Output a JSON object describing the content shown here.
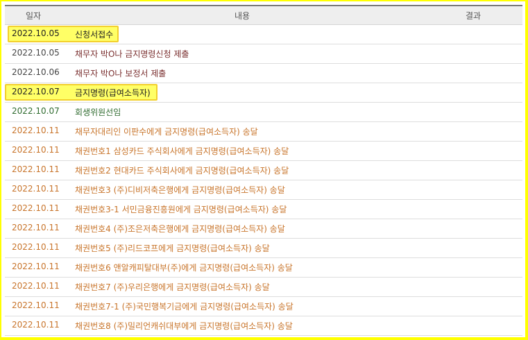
{
  "headers": {
    "date": "일자",
    "content": "내용",
    "result": "결과"
  },
  "rows": [
    {
      "date": "2022.10.05",
      "content": "신청서접수"
    },
    {
      "date": "2022.10.05",
      "content": "채무자 박O나 금지명령신청 제출"
    },
    {
      "date": "2022.10.06",
      "content": "채무자 박O나 보정서 제출"
    },
    {
      "date": "2022.10.07",
      "content": "금지명령(급여소득자)"
    },
    {
      "date": "2022.10.07",
      "content": "회생위원선임"
    },
    {
      "date": "2022.10.11",
      "content": "채무자대리인 이판수에게 금지명령(급여소득자) 송달"
    },
    {
      "date": "2022.10.11",
      "content": "채권번호1 삼성카드 주식회사에게 금지명령(급여소득자) 송달"
    },
    {
      "date": "2022.10.11",
      "content": "채권번호2 현대카드 주식회사에게 금지명령(급여소득자) 송달"
    },
    {
      "date": "2022.10.11",
      "content": "채권번호3 (주)디비저축은행에게 금지명령(급여소득자) 송달"
    },
    {
      "date": "2022.10.11",
      "content": "채권번호3-1 서민금융진흥원에게 금지명령(급여소득자) 송달"
    },
    {
      "date": "2022.10.11",
      "content": "채권번호4 (주)조은저축은행에게 금지명령(급여소득자) 송달"
    },
    {
      "date": "2022.10.11",
      "content": "채권번호5 (주)리드코프에게 금지명령(급여소득자) 송달"
    },
    {
      "date": "2022.10.11",
      "content": "채권번호6 앤알캐피탈대부(주)에게 금지명령(급여소득자) 송달"
    },
    {
      "date": "2022.10.11",
      "content": "채권번호7 (주)우리은행에게 금지명령(급여소득자) 송달"
    },
    {
      "date": "2022.10.11",
      "content": "채권번호7-1 (주)국민행복기금에게 금지명령(급여소득자) 송달"
    },
    {
      "date": "2022.10.11",
      "content": "채권번호8 (주)밀리언캐쉬대부에게 금지명령(급여소득자) 송달"
    }
  ],
  "colors": {
    "border": "#ffff00",
    "highlight": "#ffff66",
    "orange": "#c8742a",
    "green": "#2f6b2f",
    "maroon": "#7a2f2f"
  }
}
